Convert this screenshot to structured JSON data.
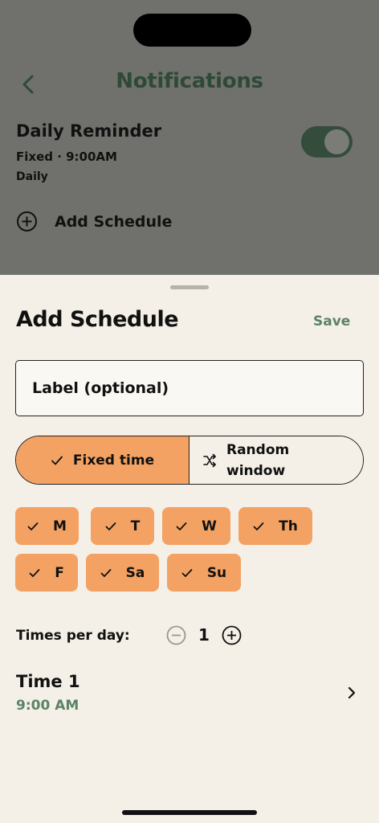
{
  "header": {
    "title": "Notifications"
  },
  "reminder": {
    "title": "Daily Reminder",
    "subtitle": "Fixed · 9:00AM",
    "frequency": "Daily",
    "enabled": true
  },
  "add_schedule_row": {
    "label": "Add Schedule"
  },
  "sheet": {
    "title": "Add Schedule",
    "save_label": "Save",
    "label_placeholder": "Label (optional)",
    "modes": [
      {
        "label": "Fixed time",
        "selected": true
      },
      {
        "label": "Random window",
        "selected": false
      }
    ],
    "days": [
      {
        "label": "M",
        "selected": true
      },
      {
        "label": "T",
        "selected": true
      },
      {
        "label": "W",
        "selected": true
      },
      {
        "label": "Th",
        "selected": true
      },
      {
        "label": "F",
        "selected": true
      },
      {
        "label": "Sa",
        "selected": true
      },
      {
        "label": "Su",
        "selected": true
      }
    ],
    "times_per_day_label": "Times per day:",
    "times_per_day": "1",
    "times": [
      {
        "title": "Time 1",
        "value": "9:00 AM"
      }
    ]
  },
  "colors": {
    "accent": "#f3a263",
    "green": "#5a8466",
    "dark_green": "#2e4a37",
    "sheet_bg": "#f4efe7"
  }
}
